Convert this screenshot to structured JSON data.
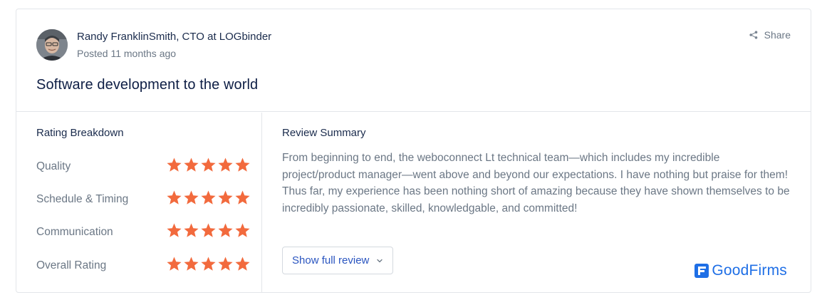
{
  "review": {
    "author": "Randy FranklinSmith, CTO at LOGbinder",
    "posted": "Posted 11 months ago",
    "share_label": "Share",
    "title": "Software development to the world"
  },
  "ratings": {
    "heading": "Rating Breakdown",
    "max_stars": 5,
    "items": [
      {
        "label": "Quality",
        "stars": 5
      },
      {
        "label": "Schedule & Timing",
        "stars": 5
      },
      {
        "label": "Communication",
        "stars": 5
      },
      {
        "label": "Overall Rating",
        "stars": 5
      }
    ]
  },
  "summary": {
    "heading": "Review Summary",
    "text": "From beginning to end, the weboconnect Lt technical team—which includes my incredible project/product manager—went above and beyond our expectations. I have nothing but praise for them! Thus far, my experience has been nothing short of amazing because they have shown themselves to be incredibly passionate, skilled, knowledgable, and committed!",
    "button_label": "Show full review"
  },
  "brand": {
    "name": "GoodFirms",
    "icon": "goodfirms-logo-icon"
  },
  "colors": {
    "star": "#f26a3d",
    "brand": "#1f6fe6",
    "link": "#2a55c0",
    "title": "#0e1e45",
    "muted": "#6b7785",
    "border": "#e3e6ea"
  }
}
